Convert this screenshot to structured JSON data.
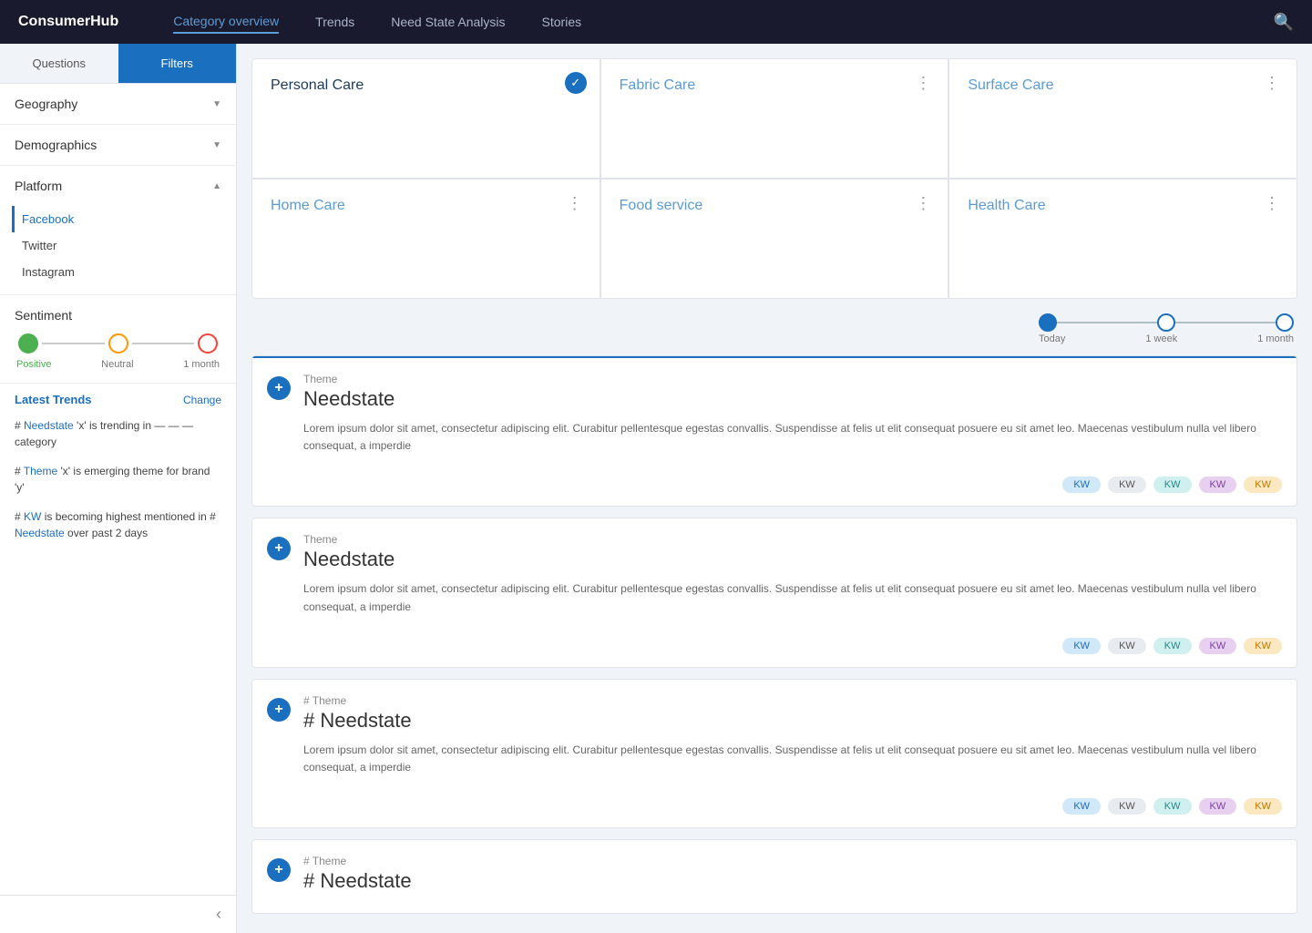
{
  "app": {
    "logo": "ConsumerHub",
    "nav_items": [
      "Category overview",
      "Trends",
      "Need State Analysis",
      "Stories"
    ],
    "active_nav": "Category overview"
  },
  "sidebar": {
    "tab_questions": "Questions",
    "tab_filters": "Filters",
    "active_tab": "Questions",
    "filters": [
      {
        "id": "geography",
        "label": "Geography",
        "expanded": false,
        "items": []
      },
      {
        "id": "demographics",
        "label": "Demographics",
        "expanded": false,
        "items": []
      },
      {
        "id": "platform",
        "label": "Platform",
        "expanded": true,
        "items": [
          "Facebook",
          "Twitter",
          "Instagram"
        ]
      }
    ],
    "active_platform": "Facebook",
    "sentiment": {
      "label": "Sentiment",
      "labels": [
        "Positive",
        "Neutral",
        "1 month"
      ]
    },
    "latest_trends": {
      "title": "Latest Trends",
      "change_label": "Change",
      "items": [
        "# Needstate 'x' is trending in — — — category",
        "# Theme 'x' is emerging theme for brand 'y'",
        "# KW is becoming highest mentioned in # Needstate over past 2 days"
      ]
    }
  },
  "categories": [
    {
      "id": "personal-care",
      "name": "Personal Care",
      "selected": true,
      "menu": false
    },
    {
      "id": "fabric-care",
      "name": "Fabric Care",
      "selected": false,
      "menu": true
    },
    {
      "id": "surface-care",
      "name": "Surface Care",
      "selected": false,
      "menu": true
    },
    {
      "id": "home-care",
      "name": "Home Care",
      "selected": false,
      "menu": true
    },
    {
      "id": "food-service",
      "name": "Food service",
      "selected": false,
      "menu": true
    },
    {
      "id": "health-care",
      "name": "Health Care",
      "selected": false,
      "menu": true
    }
  ],
  "time_slider": {
    "points": [
      "Today",
      "1 week",
      "1 month"
    ],
    "active": 0
  },
  "need_state_cards": [
    {
      "id": 1,
      "theme_label": "Theme",
      "hash_prefix": "",
      "title": "Needstate",
      "description": "Lorem ipsum dolor sit amet, consectetur adipiscing elit. Curabitur pellentesque egestas convallis. Suspendisse at felis ut elit consequat posuere eu sit amet leo. Maecenas vestibulum nulla vel libero consequat, a imperdie",
      "tags": [
        {
          "label": "KW",
          "color": "blue"
        },
        {
          "label": "KW",
          "color": "gray"
        },
        {
          "label": "KW",
          "color": "teal"
        },
        {
          "label": "KW",
          "color": "purple"
        },
        {
          "label": "KW",
          "color": "orange"
        }
      ],
      "has_divider": true
    },
    {
      "id": 2,
      "theme_label": "Theme",
      "hash_prefix": "",
      "title": "Needstate",
      "description": "Lorem ipsum dolor sit amet, consectetur adipiscing elit. Curabitur pellentesque egestas convallis. Suspendisse at felis ut elit consequat posuere eu sit amet leo. Maecenas vestibulum nulla vel libero consequat, a imperdie",
      "tags": [
        {
          "label": "KW",
          "color": "blue"
        },
        {
          "label": "KW",
          "color": "gray"
        },
        {
          "label": "KW",
          "color": "teal"
        },
        {
          "label": "KW",
          "color": "purple"
        },
        {
          "label": "KW",
          "color": "orange"
        }
      ],
      "has_divider": false
    },
    {
      "id": 3,
      "theme_label": "# Theme",
      "hash_prefix": "# ",
      "title": "Needstate",
      "description": "Lorem ipsum dolor sit amet, consectetur adipiscing elit. Curabitur pellentesque egestas convallis. Suspendisse at felis ut elit consequat posuere eu sit amet leo. Maecenas vestibulum nulla vel libero consequat, a imperdie",
      "tags": [
        {
          "label": "KW",
          "color": "blue"
        },
        {
          "label": "KW",
          "color": "gray"
        },
        {
          "label": "KW",
          "color": "teal"
        },
        {
          "label": "KW",
          "color": "purple"
        },
        {
          "label": "KW",
          "color": "orange"
        }
      ],
      "has_divider": false
    },
    {
      "id": 4,
      "theme_label": "# Theme",
      "hash_prefix": "# ",
      "title": "Needstate",
      "description": "",
      "tags": [],
      "has_divider": false
    }
  ]
}
